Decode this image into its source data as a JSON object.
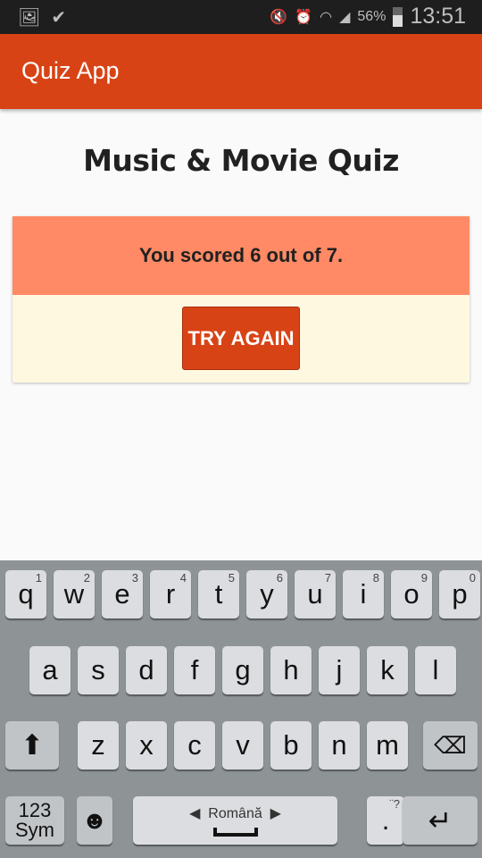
{
  "status": {
    "battery": "56%",
    "time": "13:51",
    "icons": [
      "image-icon",
      "clipboard-check-icon",
      "mute-icon",
      "alarm-icon",
      "wifi-icon",
      "signal-icon",
      "battery-icon"
    ]
  },
  "appbar": {
    "title": "Quiz App"
  },
  "main": {
    "title": "Music & Movie Quiz",
    "score_text": "You scored 6 out of 7.",
    "try_again": "TRY AGAIN"
  },
  "colors": {
    "primary": "#d84315",
    "score_bg": "#ff8a65",
    "card_bg": "#fff8e1"
  },
  "keyboard": {
    "row1": [
      {
        "k": "q",
        "n": "1"
      },
      {
        "k": "w",
        "n": "2"
      },
      {
        "k": "e",
        "n": "3"
      },
      {
        "k": "r",
        "n": "4"
      },
      {
        "k": "t",
        "n": "5"
      },
      {
        "k": "y",
        "n": "6"
      },
      {
        "k": "u",
        "n": "7"
      },
      {
        "k": "i",
        "n": "8"
      },
      {
        "k": "o",
        "n": "9"
      },
      {
        "k": "p",
        "n": "0"
      }
    ],
    "row2": [
      "a",
      "s",
      "d",
      "f",
      "g",
      "h",
      "j",
      "k",
      "l"
    ],
    "row3": [
      "z",
      "x",
      "c",
      "v",
      "b",
      "n",
      "m"
    ],
    "sym_label_1": "123",
    "sym_label_2": "Sym",
    "space_label": "Românӑ",
    "period": ".",
    "period_hint": "¨?"
  }
}
